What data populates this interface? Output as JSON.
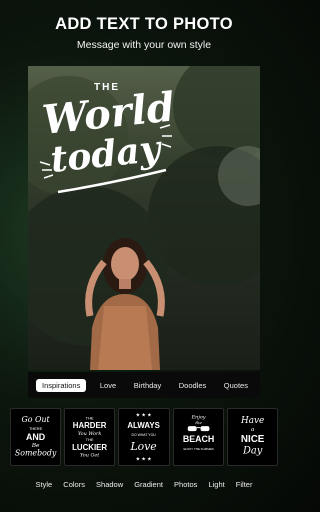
{
  "header": {
    "title": "ADD TEXT TO PHOTO",
    "subtitle": "Message with your own style"
  },
  "photo": {
    "overlay_text": {
      "the": "THE",
      "world": "World",
      "today": "today"
    }
  },
  "categories": [
    {
      "label": "Inspirations",
      "active": true
    },
    {
      "label": "Love",
      "active": false
    },
    {
      "label": "Birthday",
      "active": false
    },
    {
      "label": "Doodles",
      "active": false
    },
    {
      "label": "Quotes",
      "active": false
    }
  ],
  "stickers": [
    {
      "lines": [
        "Go Out",
        "THERE",
        "AND",
        "Be",
        "Somebody"
      ]
    },
    {
      "lines": [
        "THE",
        "HARDER",
        "You Work",
        "THE",
        "LUCKIER",
        "You Get"
      ]
    },
    {
      "lines": [
        "ALWAYS",
        "DO WHAT YOU",
        "Love"
      ]
    },
    {
      "lines": [
        "Enjoy",
        "the",
        "BEACH",
        "ENJOY THE SUMMER"
      ]
    },
    {
      "lines": [
        "Have",
        "a",
        "NICE",
        "Day"
      ]
    }
  ],
  "tools": [
    "Style",
    "Colors",
    "Shadow",
    "Gradient",
    "Photos",
    "Light",
    "Filter"
  ],
  "colors": {
    "active_chip_bg": "#ffffff",
    "active_chip_text": "#111111",
    "text": "#ffffff",
    "background": "#050805"
  }
}
